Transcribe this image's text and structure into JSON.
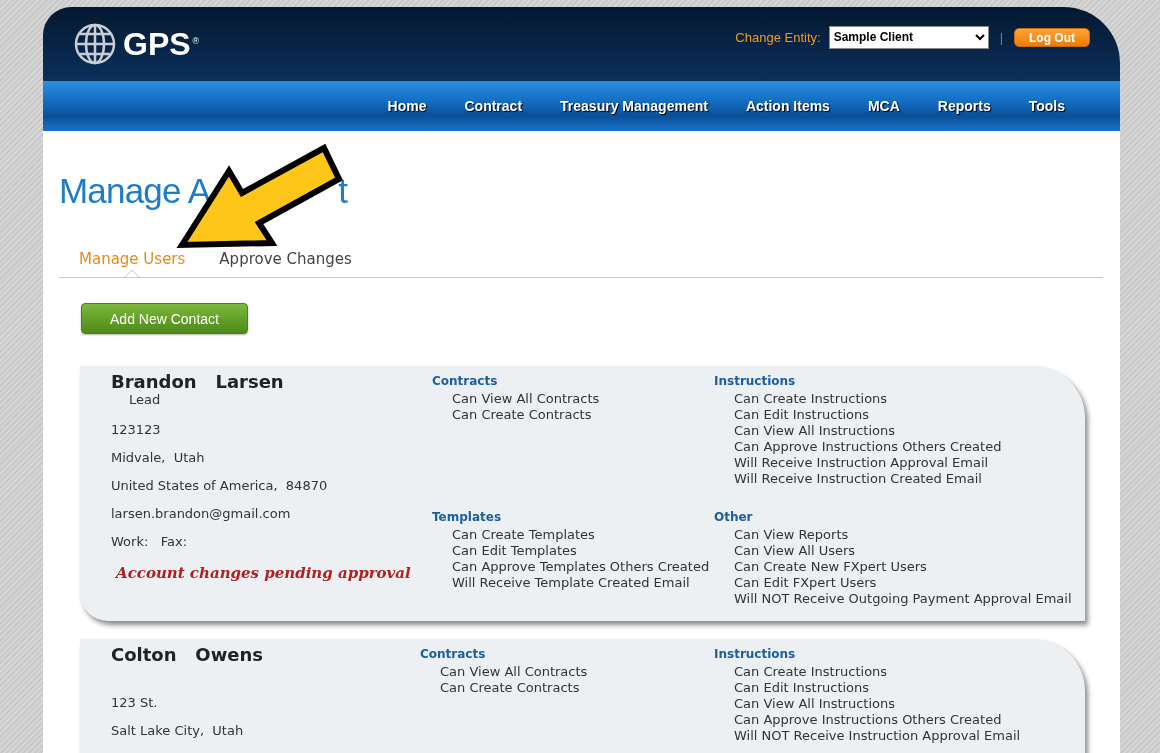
{
  "header": {
    "logo_text": "GPS",
    "logo_mark": "®",
    "entity_label": "Change Entity:",
    "entity_select": {
      "value": "Sample Client"
    },
    "separator": "|",
    "logout_button": "Log Out"
  },
  "nav": [
    {
      "label": "Home"
    },
    {
      "label": "Contract"
    },
    {
      "label": "Treasury Management"
    },
    {
      "label": "Action Items"
    },
    {
      "label": "MCA"
    },
    {
      "label": "Reports"
    },
    {
      "label": "Tools"
    }
  ],
  "page_title_parts": [
    "Manage A",
    "t"
  ],
  "annotation": {
    "kind": "arrow"
  },
  "tabs": [
    {
      "label": "Manage Users",
      "selected": true
    },
    {
      "label": "Approve Changes",
      "selected": false
    }
  ],
  "add_button": "Add New Contact",
  "contacts": [
    {
      "name": [
        "Brandon",
        "Larsen"
      ],
      "role": "Lead",
      "lines": [
        "123123",
        "Midvale,  Utah",
        "United States of America,  84870",
        "larsen.brandon@gmail.com",
        "Work:   Fax:"
      ],
      "notice": "Account changes pending approval",
      "sections": [
        {
          "title": "Contracts",
          "items": [
            "Can View All Contracts",
            "Can Create Contracts"
          ]
        },
        {
          "title": "Instructions",
          "items": [
            "Can Create Instructions",
            "Can Edit Instructions",
            "Can View All Instructions",
            "Can Approve Instructions Others Created",
            "Will Receive Instruction Approval Email",
            "Will Receive Instruction Created Email"
          ]
        },
        {
          "title": "Templates",
          "items": [
            "Can Create Templates",
            "Can Edit Templates",
            "Can Approve Templates Others Created",
            "Will Receive Template Created Email"
          ]
        },
        {
          "title": "Other",
          "items": [
            "Can View Reports",
            "Can View All Users",
            "Can Create New FXpert Users",
            "Can Edit FXpert Users",
            "Will NOT Receive Outgoing Payment Approval Email"
          ]
        }
      ]
    },
    {
      "name": [
        "Colton",
        "Owens"
      ],
      "lines": [
        "123 St.",
        "Salt Lake City,  Utah"
      ],
      "sections": [
        {
          "title": "Contracts",
          "items": [
            "Can View All Contracts",
            "Can Create Contracts"
          ]
        },
        {
          "title": "Instructions",
          "items": [
            "Can Create Instructions",
            "Can Edit Instructions",
            "Can View All Instructions",
            "Can Approve Instructions Others Created",
            "Will NOT Receive Instruction Approval Email"
          ]
        }
      ]
    }
  ]
}
